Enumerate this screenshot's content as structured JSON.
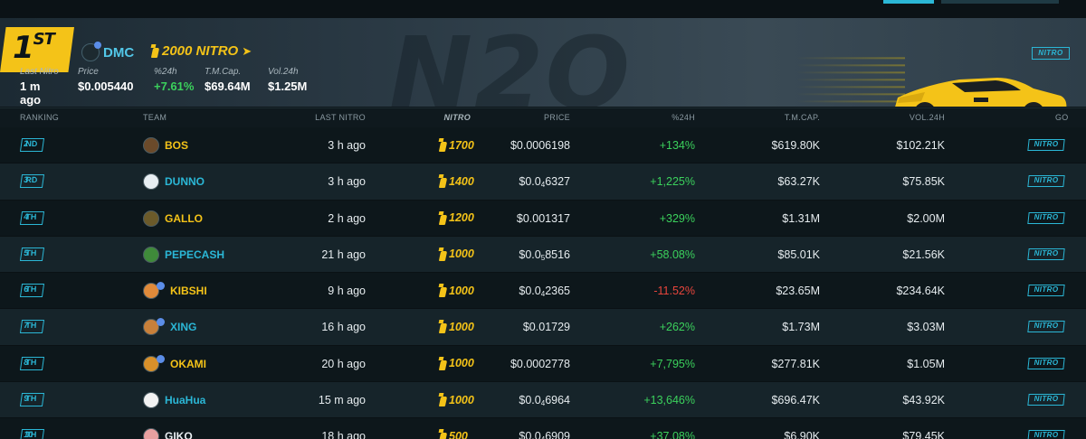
{
  "colors": {
    "accent": "#2bb7d6",
    "gold": "#f4c318",
    "positive": "#3bd15c",
    "negative": "#e8453c"
  },
  "hero": {
    "rank_label": "1",
    "rank_suffix": "ST",
    "token_name": "DMC",
    "token_icon": "dmc-token-icon",
    "nitro_amount": "2000 NITRO",
    "nitro_button": "NITRO",
    "watermark": "N2O",
    "stats": [
      {
        "label": "Last Nitro",
        "value": "1 m ago"
      },
      {
        "label": "Price",
        "value": "$0.005440"
      },
      {
        "label": "%24h",
        "value": "+7.61%"
      },
      {
        "label": "T.M.Cap.",
        "value": "$69.64M"
      },
      {
        "label": "Vol.24h",
        "value": "$1.25M"
      }
    ]
  },
  "table": {
    "headers": {
      "ranking": "RANKING",
      "team": "TEAM",
      "last_nitro": "LAST NITRO",
      "nitro": "NITRO",
      "price": "PRICE",
      "change": "%24H",
      "mcap": "T.M.CAP.",
      "vol": "VOL.24H",
      "go": "GO"
    },
    "go_label": "NITRO",
    "rows": [
      {
        "rank": "2",
        "suffix": "ND",
        "team": "BOS",
        "team_color": "#f4c318",
        "avatar": "bos-avatar",
        "avatar_color": "#6b4a2a",
        "chain": false,
        "last": "3 h ago",
        "nitro": "1700",
        "price": "$0.0006198",
        "price_sub": "",
        "price_tail": "",
        "change": "+134%",
        "change_type": "green",
        "mcap": "$619.80K",
        "vol": "$102.21K"
      },
      {
        "rank": "3",
        "suffix": "RD",
        "team": "DUNNO",
        "team_color": "#2bb7d6",
        "avatar": "dunno-avatar",
        "avatar_color": "#e8eef2",
        "chain": false,
        "last": "3 h ago",
        "nitro": "1400",
        "price": "$0.0",
        "price_sub": "4",
        "price_tail": "6327",
        "change": "+1,225%",
        "change_type": "green",
        "mcap": "$63.27K",
        "vol": "$75.85K"
      },
      {
        "rank": "4",
        "suffix": "TH",
        "team": "GALLO",
        "team_color": "#f4c318",
        "avatar": "gallo-avatar",
        "avatar_color": "#6b5a2a",
        "chain": false,
        "last": "2 h ago",
        "nitro": "1200",
        "price": "$0.001317",
        "price_sub": "",
        "price_tail": "",
        "change": "+329%",
        "change_type": "green",
        "mcap": "$1.31M",
        "vol": "$2.00M"
      },
      {
        "rank": "5",
        "suffix": "TH",
        "team": "PEPECASH",
        "team_color": "#2bb7d6",
        "avatar": "pepecash-avatar",
        "avatar_color": "#3f8a3a",
        "chain": false,
        "last": "21 h ago",
        "nitro": "1000",
        "price": "$0.0",
        "price_sub": "5",
        "price_tail": "8516",
        "change": "+58.08%",
        "change_type": "green",
        "mcap": "$85.01K",
        "vol": "$21.56K"
      },
      {
        "rank": "6",
        "suffix": "TH",
        "team": "KIBSHI",
        "team_color": "#f4c318",
        "avatar": "kibshi-avatar",
        "avatar_color": "#e08a3a",
        "chain": true,
        "last": "9 h ago",
        "nitro": "1000",
        "price": "$0.0",
        "price_sub": "4",
        "price_tail": "2365",
        "change": "-11.52%",
        "change_type": "red",
        "mcap": "$23.65M",
        "vol": "$234.64K"
      },
      {
        "rank": "7",
        "suffix": "TH",
        "team": "XING",
        "team_color": "#2bb7d6",
        "avatar": "xing-avatar",
        "avatar_color": "#c8803a",
        "chain": true,
        "last": "16 h ago",
        "nitro": "1000",
        "price": "$0.01729",
        "price_sub": "",
        "price_tail": "",
        "change": "+262%",
        "change_type": "green",
        "mcap": "$1.73M",
        "vol": "$3.03M"
      },
      {
        "rank": "8",
        "suffix": "TH",
        "team": "OKAMI",
        "team_color": "#f4c318",
        "avatar": "okami-avatar",
        "avatar_color": "#d8902a",
        "chain": true,
        "last": "20 h ago",
        "nitro": "1000",
        "price": "$0.0002778",
        "price_sub": "",
        "price_tail": "",
        "change": "+7,795%",
        "change_type": "green",
        "mcap": "$277.81K",
        "vol": "$1.05M"
      },
      {
        "rank": "9",
        "suffix": "TH",
        "team": "HuaHua",
        "team_color": "#2bb7d6",
        "avatar": "huahua-avatar",
        "avatar_color": "#f2f2f2",
        "chain": false,
        "last": "15 m ago",
        "nitro": "1000",
        "price": "$0.0",
        "price_sub": "4",
        "price_tail": "6964",
        "change": "+13,646%",
        "change_type": "green",
        "mcap": "$696.47K",
        "vol": "$43.92K"
      },
      {
        "rank": "10",
        "suffix": "TH",
        "team": "GIKO",
        "team_color": "#e8eef2",
        "avatar": "giko-avatar",
        "avatar_color": "#e8a0a0",
        "chain": false,
        "last": "18 h ago",
        "nitro": "500",
        "price": "$0.0",
        "price_sub": "4",
        "price_tail": "6909",
        "change": "+37.08%",
        "change_type": "green",
        "mcap": "$6.90K",
        "vol": "$79.45K"
      }
    ]
  }
}
